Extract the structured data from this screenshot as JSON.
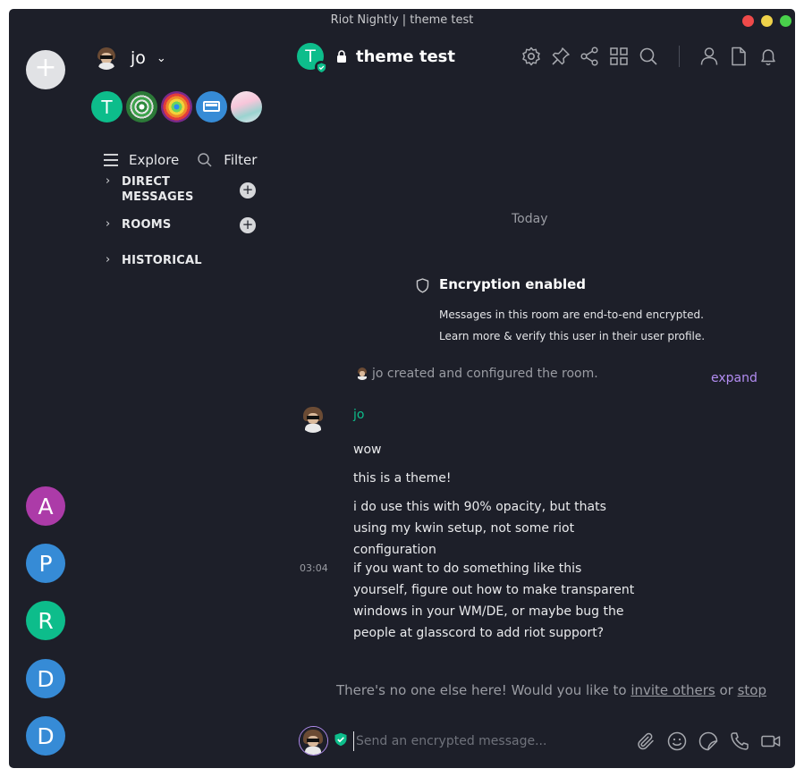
{
  "window": {
    "title": "Riot Nightly | theme test"
  },
  "left_rail": {
    "add_label": "+",
    "avatars": [
      {
        "letter": "A",
        "color": "#ac3ba8"
      },
      {
        "letter": "P",
        "color": "#368bd6"
      },
      {
        "letter": "R",
        "color": "#0dbd8b"
      },
      {
        "letter": "D",
        "color": "#368bd6"
      },
      {
        "letter": "D",
        "color": "#368bd6"
      }
    ]
  },
  "sidebar": {
    "user_name": "jo",
    "room_initial": "T",
    "explore_label": "Explore",
    "filter_label": "Filter",
    "sections": {
      "direct_messages": "DIRECT\nMESSAGES",
      "direct_messages_line1": "DIRECT",
      "direct_messages_line2": "MESSAGES",
      "rooms": "ROOMS",
      "historical": "HISTORICAL"
    }
  },
  "room": {
    "initial": "T",
    "name": "theme test",
    "header_icons": [
      "settings-icon",
      "pin-icon",
      "share-icon",
      "apps-icon",
      "search-icon",
      "member-list-icon",
      "files-icon",
      "notifications-icon"
    ]
  },
  "timeline": {
    "date_separator": "Today",
    "encryption": {
      "title": "Encryption enabled",
      "line1": "Messages in this room are end-to-end encrypted.",
      "line2": "Learn more & verify this user in their user profile."
    },
    "created_event": "jo created and configured the room.",
    "expand_label": "expand",
    "sender": "jo",
    "messages": [
      {
        "lines": [
          "wow"
        ]
      },
      {
        "lines": [
          "this is a theme!"
        ]
      },
      {
        "lines": [
          "i do use this with 90% opacity, but thats",
          "using my kwin setup, not some riot",
          "configuration"
        ]
      },
      {
        "lines": [
          "if you want to do something like this",
          "yourself, figure out how to make transparent",
          "windows in your WM/DE, or maybe bug the",
          "people at glasscord to add riot support?"
        ]
      }
    ],
    "timestamp": "03:04",
    "invite": {
      "prefix": "There's no one else here! Would you like to ",
      "invite_link": "invite others",
      "middle": " or ",
      "stop_link": "stop"
    }
  },
  "composer": {
    "placeholder": "Send an encrypted message...",
    "icons": [
      "attachment-icon",
      "emoji-icon",
      "sticker-icon",
      "voice-call-icon",
      "video-call-icon"
    ]
  },
  "colors": {
    "background": "#1d1f29",
    "accent_green": "#0dbd8b",
    "accent_purple": "#b38df2"
  }
}
